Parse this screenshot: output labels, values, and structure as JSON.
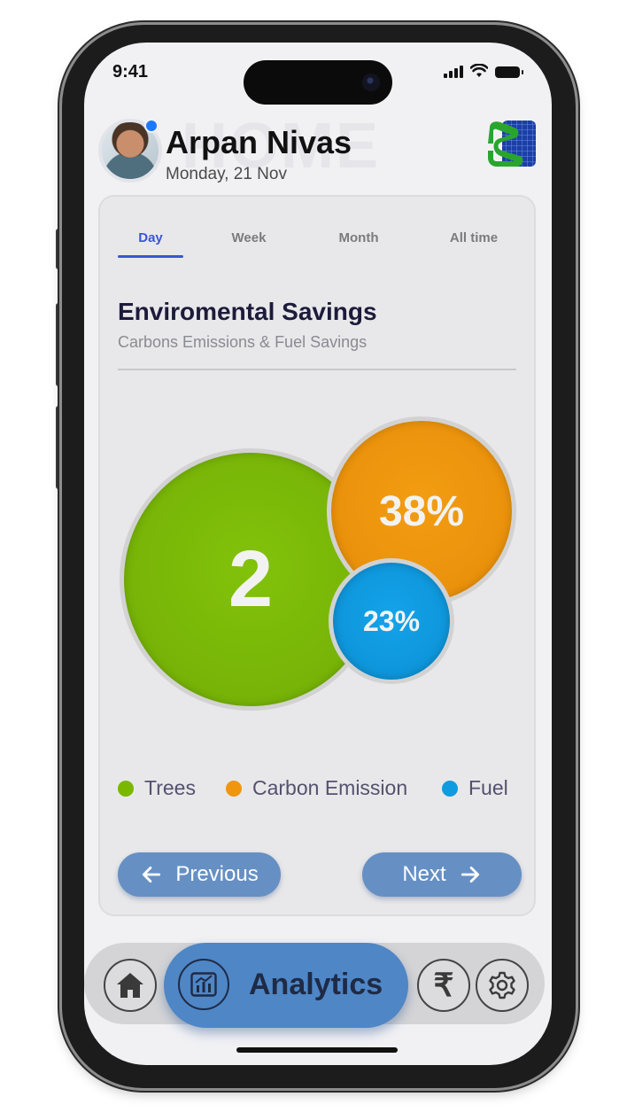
{
  "status_bar": {
    "time": "9:41"
  },
  "header": {
    "user_name": "Arpan Nivas",
    "date": "Monday, 21 Nov",
    "watermark": "HOME"
  },
  "tabs": [
    {
      "label": "Day",
      "active": true
    },
    {
      "label": "Week",
      "active": false
    },
    {
      "label": "Month",
      "active": false
    },
    {
      "label": "All time",
      "active": false
    }
  ],
  "card": {
    "title": "Enviromental Savings",
    "subtitle": "Carbons Emissions & Fuel Savings"
  },
  "bubbles": {
    "trees": "2",
    "carbon": "38%",
    "fuel": "23%"
  },
  "legend": [
    {
      "label": "Trees",
      "color": "#7ab800"
    },
    {
      "label": "Carbon Emission",
      "color": "#f0960e"
    },
    {
      "label": "Fuel",
      "color": "#0e9be0"
    }
  ],
  "buttons": {
    "previous": "Previous",
    "next": "Next"
  },
  "bottom_nav": {
    "active_label": "Analytics",
    "items": [
      "home-icon",
      "analytics-icon",
      "rupee-icon",
      "settings-icon"
    ]
  },
  "colors": {
    "accent": "#3a56d4",
    "button": "#6690c4",
    "nav_pill": "#4e86c6"
  }
}
